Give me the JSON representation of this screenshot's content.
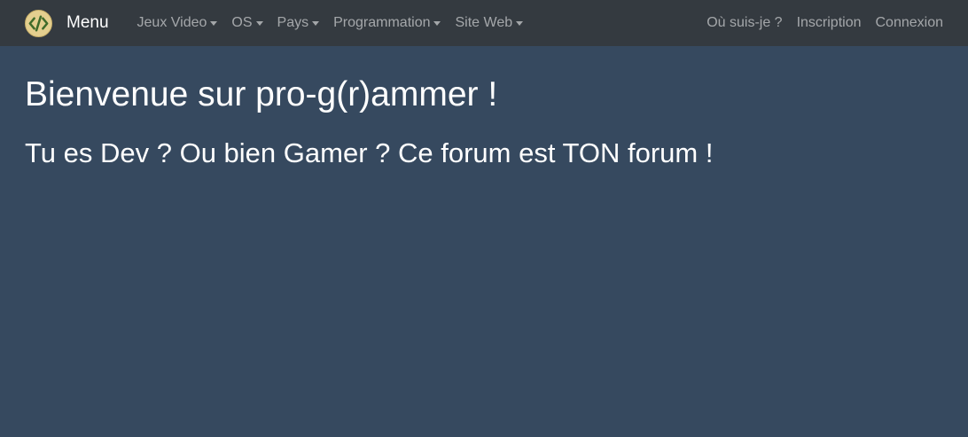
{
  "navbar": {
    "brand_label": "Menu",
    "logo_icon": "code-brackets-icon",
    "left_items": [
      {
        "label": "Jeux Video",
        "dropdown": true
      },
      {
        "label": "OS",
        "dropdown": true
      },
      {
        "label": "Pays",
        "dropdown": true
      },
      {
        "label": "Programmation",
        "dropdown": true
      },
      {
        "label": "Site Web",
        "dropdown": true
      }
    ],
    "right_items": [
      {
        "label": "Où suis-je ?"
      },
      {
        "label": "Inscription"
      },
      {
        "label": "Connexion"
      }
    ]
  },
  "main": {
    "title": "Bienvenue sur pro-g(r)ammer !",
    "subtitle": "Tu es Dev ? Ou bien Gamer ? Ce forum est TON forum !"
  },
  "colors": {
    "navbar_bg": "#343a40",
    "page_bg": "#36495f",
    "logo_bg": "#e4cf8f",
    "logo_green": "#3f6b2a"
  }
}
